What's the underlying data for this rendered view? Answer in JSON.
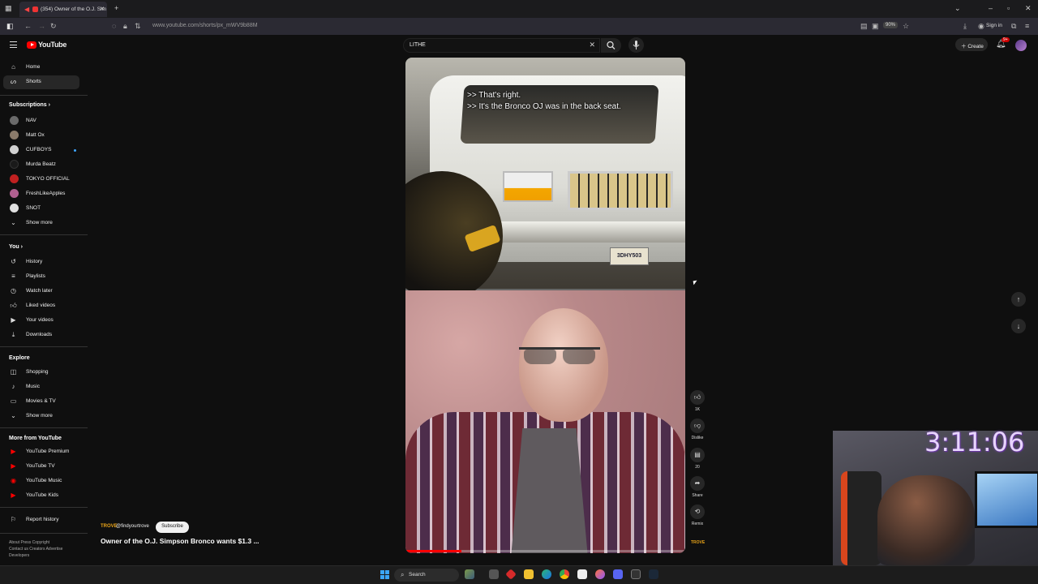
{
  "browser": {
    "tab_title": "(354) Owner of the O.J. Sim",
    "url": "www.youtube.com/shorts/px_mWV9b88M",
    "zoom": "90%",
    "signin_label": "Sign in"
  },
  "masthead": {
    "logo_text": "YouTube",
    "search_value": "LITHE",
    "create_label": "Create",
    "notif_count": "9+"
  },
  "sidebar": {
    "main": [
      {
        "label": "Home",
        "icon": "home-icon"
      },
      {
        "label": "Shorts",
        "icon": "shorts-icon",
        "active": true
      }
    ],
    "subscriptions_header": "Subscriptions",
    "subscriptions": [
      {
        "label": "NAV",
        "color": "#6a6a6a"
      },
      {
        "label": "Matt Ox",
        "color": "#8a7a6a"
      },
      {
        "label": "CUFBOYS",
        "color": "#d0d0d0",
        "live": true
      },
      {
        "label": "Murda Beatz",
        "color": "#1a1a1a"
      },
      {
        "label": "TOKYO OFFICIAL",
        "color": "#c02020"
      },
      {
        "label": "FreshLikeApples",
        "color": "#b06090"
      },
      {
        "label": "SNOT",
        "color": "#e0e0e0"
      }
    ],
    "show_more_1": "Show more",
    "you_header": "You",
    "you_items": [
      {
        "label": "History",
        "icon": "history-icon"
      },
      {
        "label": "Playlists",
        "icon": "playlists-icon"
      },
      {
        "label": "Watch later",
        "icon": "watch-later-icon"
      },
      {
        "label": "Liked videos",
        "icon": "liked-videos-icon"
      },
      {
        "label": "Your videos",
        "icon": "your-videos-icon"
      },
      {
        "label": "Downloads",
        "icon": "downloads-icon"
      }
    ],
    "explore_header": "Explore",
    "explore_items": [
      {
        "label": "Shopping",
        "icon": "shopping-icon"
      },
      {
        "label": "Music",
        "icon": "music-icon"
      },
      {
        "label": "Movies & TV",
        "icon": "movies-icon"
      }
    ],
    "show_more_2": "Show more",
    "more_header": "More from YouTube",
    "more_items": [
      {
        "label": "YouTube Premium"
      },
      {
        "label": "YouTube TV"
      },
      {
        "label": "YouTube Music"
      },
      {
        "label": "YouTube Kids"
      }
    ],
    "report_history": "Report history",
    "footer_1": "About  Press  Copyright",
    "footer_2": "Contact us  Creators  Advertise",
    "footer_3": "Developers"
  },
  "short": {
    "caption_1": ">> That's right.",
    "caption_2": ">> It's the Bronco OJ was in the back seat.",
    "plate_text": "3DHY503",
    "channel_logo": "TROVE",
    "channel": "@findyourtrove",
    "subscribe_label": "Subscribe",
    "title": "Owner of the O.J. Simpson Bronco wants $1.3 ...",
    "progress": 0.2
  },
  "actions": {
    "like_count": "1K",
    "dislike_label": "Dislike",
    "comment_count": "20",
    "share_label": "Share",
    "remix_label": "Remix",
    "remix_logo": "TROVE"
  },
  "overlay": {
    "timer": "3:11:06"
  },
  "taskbar": {
    "search_label": "Search"
  }
}
